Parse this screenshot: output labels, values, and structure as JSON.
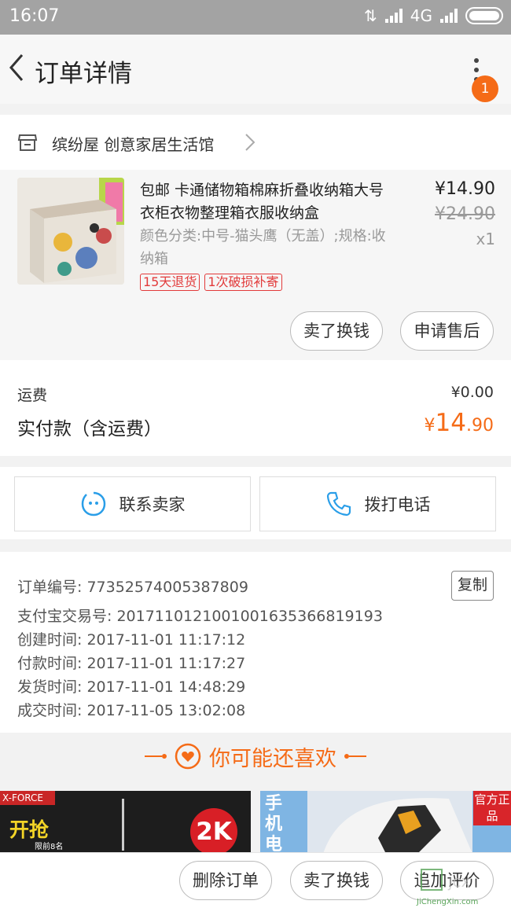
{
  "status_bar": {
    "time": "16:07",
    "network": "4G"
  },
  "header": {
    "title": "订单详情",
    "notification_count": "1"
  },
  "shop": {
    "name": "缤纷屋 创意家居生活馆"
  },
  "product": {
    "name": "包邮 卡通储物箱棉麻折叠收纳箱大号 衣柜衣物整理箱衣服收纳盒",
    "spec": "颜色分类:中号-猫头鹰（无盖）;规格:收纳箱",
    "tags": [
      "15天退货",
      "1次破损补寄"
    ],
    "price": "¥14.90",
    "original_price": "¥24.90",
    "quantity": "x1",
    "actions": {
      "sell_label": "卖了换钱",
      "after_sale_label": "申请售后"
    }
  },
  "payment": {
    "shipping_label": "运费",
    "shipping_value": "¥0.00",
    "total_label": "实付款（含运费）",
    "total_currency": "¥",
    "total_int": "14",
    "total_dec": ".90"
  },
  "contact": {
    "seller_label": "联系卖家",
    "phone_label": "拨打电话"
  },
  "order_info": {
    "copy_label": "复制",
    "rows": [
      "订单编号: 77352574005387809",
      "支付宝交易号: 2017110121001001635366819193",
      "创建时间: 2017-11-01 11:17:12",
      "付款时间: 2017-11-01 11:17:27",
      "发货时间: 2017-11-01 14:48:29",
      "成交时间: 2017-11-05 13:02:08"
    ]
  },
  "recommend": {
    "title": "你可能还喜欢",
    "item1": {
      "brand": "X-FORCE",
      "promo": "开抢",
      "limit": "限前8名",
      "badge": "2K"
    },
    "item2": {
      "vertical_text": "手机电",
      "tag": "官方正品"
    }
  },
  "bottom_actions": {
    "delete_label": "删除订单",
    "sell_label": "卖了换钱",
    "review_label": "追加评价"
  },
  "watermark": {
    "text": "JiChengXin.com"
  },
  "colors": {
    "accent": "#f56b17",
    "contact_blue": "#2a9ee8",
    "tag_red": "#e23a3a"
  }
}
